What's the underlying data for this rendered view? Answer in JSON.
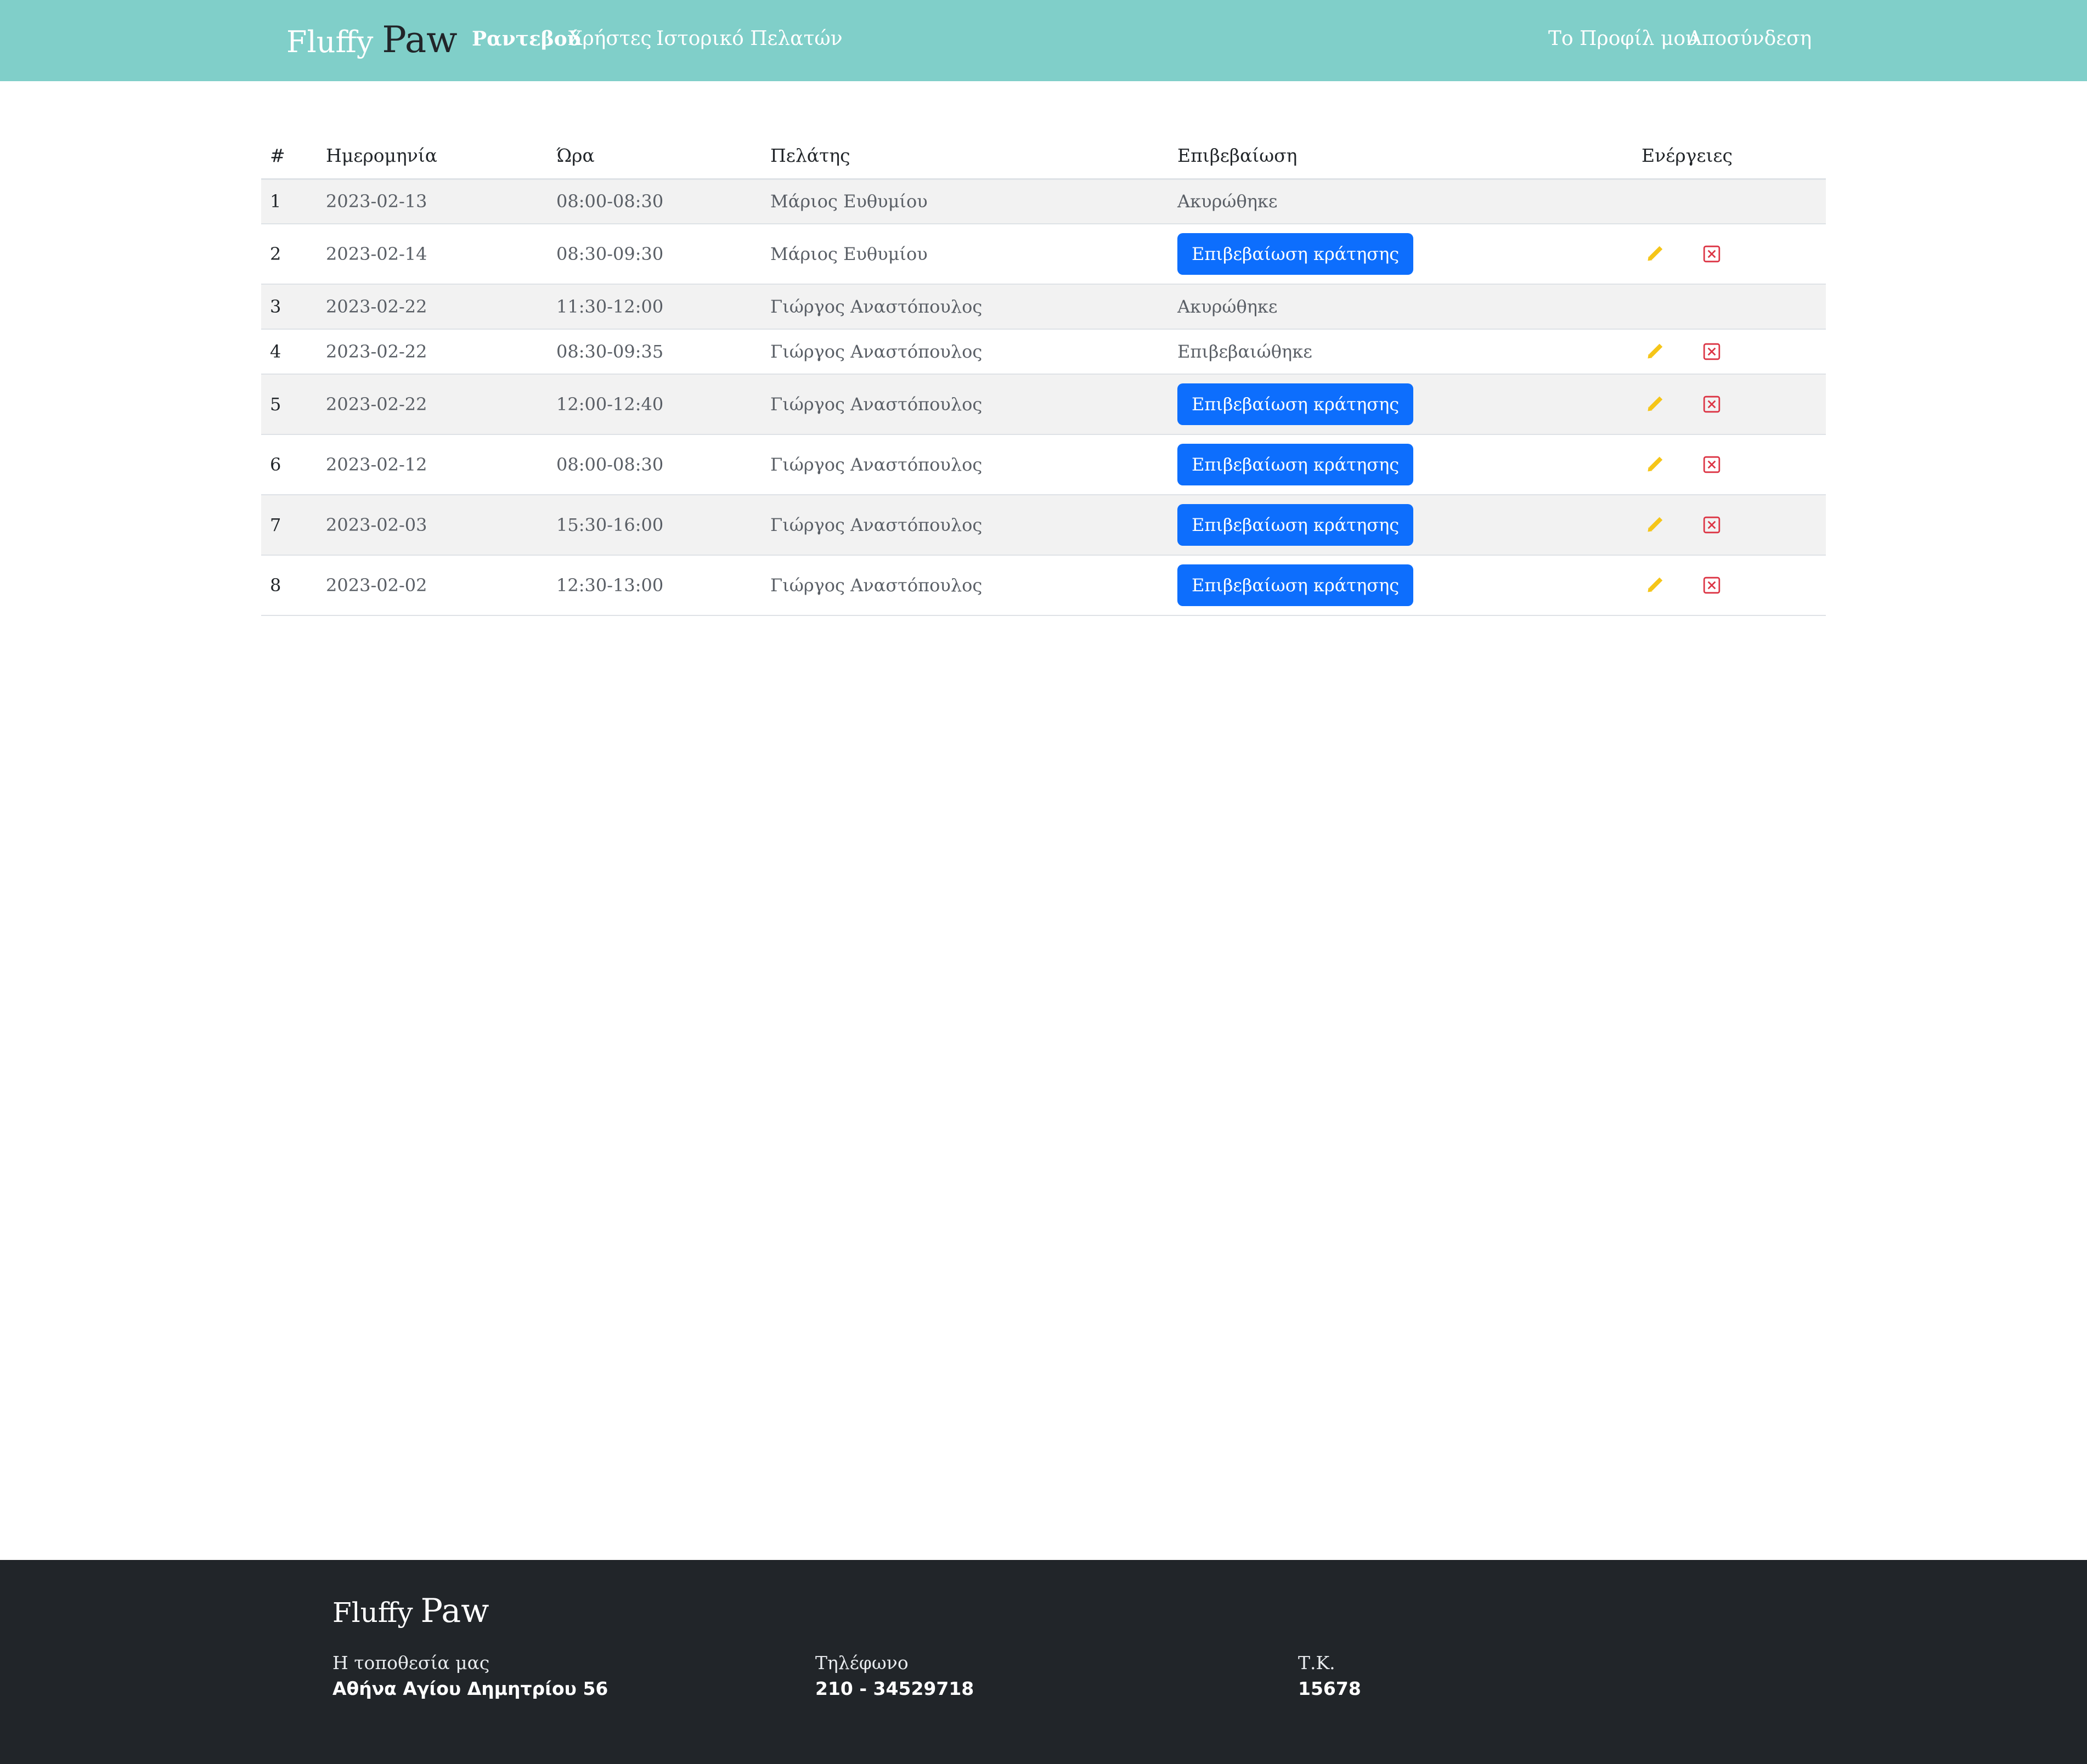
{
  "brand": {
    "first": "Fluffy",
    "second": "Paw"
  },
  "nav": {
    "items": [
      {
        "label": "Ραντεβού",
        "active": true
      },
      {
        "label": "Χρήστες",
        "active": false
      },
      {
        "label": "Ιστορικό Πελατών",
        "active": false
      }
    ],
    "right": [
      {
        "label": "Το Προφίλ μου"
      },
      {
        "label": "Αποσύνδεση"
      }
    ]
  },
  "table": {
    "headers": [
      "#",
      "Ημερομηνία",
      "Ώρα",
      "Πελάτης",
      "Επιβεβαίωση",
      "Ενέργειες"
    ],
    "rows": [
      {
        "num": "1",
        "date": "2023-02-13",
        "time": "08:00-08:30",
        "client": "Μάριος Ευθυμίου",
        "status": "Ακυρώθηκε"
      },
      {
        "num": "2",
        "date": "2023-02-14",
        "time": "08:30-09:30",
        "client": "Μάριος Ευθυμίου",
        "button": "Επιβεβαίωση κράτησης"
      },
      {
        "num": "3",
        "date": "2023-02-22",
        "time": "11:30-12:00",
        "client": "Γιώργος Αναστόπουλος",
        "status": "Ακυρώθηκε"
      },
      {
        "num": "4",
        "date": "2023-02-22",
        "time": "08:30-09:35",
        "client": "Γιώργος Αναστόπουλος",
        "status": "Επιβεβαιώθηκε"
      },
      {
        "num": "5",
        "date": "2023-02-22",
        "time": "12:00-12:40",
        "client": "Γιώργος Αναστόπουλος",
        "button": "Επιβεβαίωση κράτησης"
      },
      {
        "num": "6",
        "date": "2023-02-12",
        "time": "08:00-08:30",
        "client": "Γιώργος Αναστόπουλος",
        "button": "Επιβεβαίωση κράτησης"
      },
      {
        "num": "7",
        "date": "2023-02-03",
        "time": "15:30-16:00",
        "client": "Γιώργος Αναστόπουλος",
        "button": "Επιβεβαίωση κράτησης"
      },
      {
        "num": "8",
        "date": "2023-02-02",
        "time": "12:30-13:00",
        "client": "Γιώργος Αναστόπουλος",
        "button": "Επιβεβαίωση κράτησης"
      }
    ]
  },
  "icons": {
    "edit": "pencil-icon",
    "delete": "close-box-icon"
  },
  "colors": {
    "navbar": "#80cfc9",
    "primary_button": "#0d6efd",
    "edit_icon": "#f5c518",
    "delete_icon": "#dc3545",
    "footer": "#212529",
    "stripe": "#f2f2f2"
  },
  "footer": {
    "brand": {
      "first": "Fluffy",
      "second": "Paw"
    },
    "location": {
      "label": "Η τοποθεσία μας",
      "value": "Αθήνα Αγίου Δημητρίου 56"
    },
    "phone": {
      "label": "Τηλέφωνο",
      "value": "210 - 34529718"
    },
    "zip": {
      "label": "Τ.Κ.",
      "value": "15678"
    }
  }
}
